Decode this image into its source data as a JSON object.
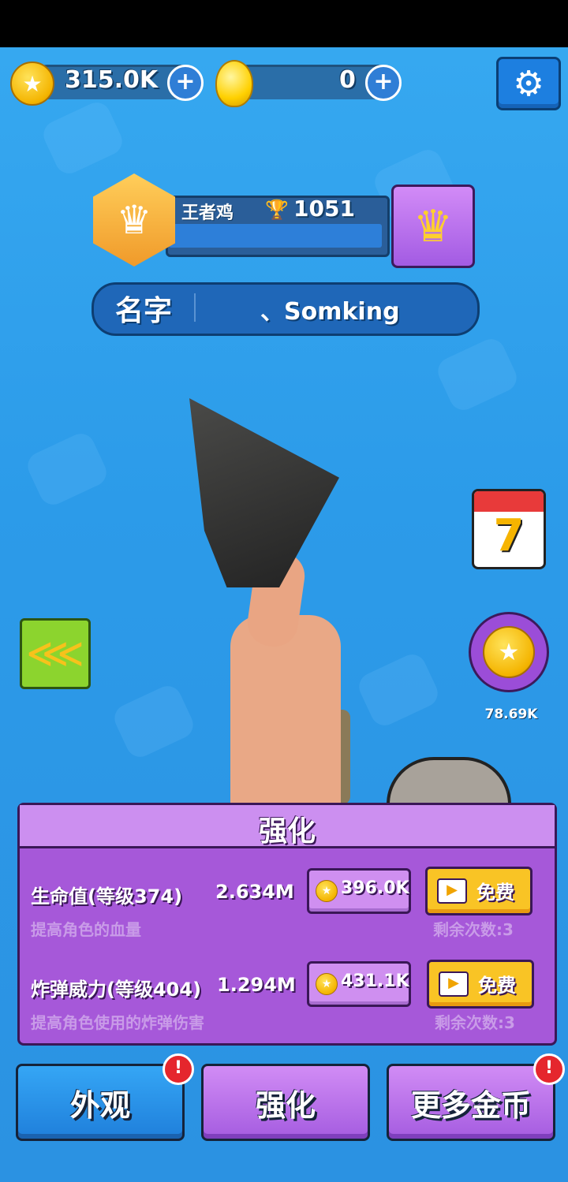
{
  "currency": {
    "coins_value": "315.0K",
    "eggs_value": "0"
  },
  "settings": {
    "icon": "gear-icon"
  },
  "rank": {
    "name": "王者鸡",
    "trophies": "1051"
  },
  "player": {
    "name_label": "名字",
    "name_value": "、Somking"
  },
  "side": {
    "calendar_day": "7",
    "offline_coins": "78.69K"
  },
  "upgrade_panel": {
    "title": "强化",
    "items": [
      {
        "name": "生命值(等级374)",
        "value": "2.634M",
        "description": "提高角色的血量",
        "cost": "396.0K",
        "free_label": "免费",
        "remaining": "剩余次数:3"
      },
      {
        "name": "炸弹威力(等级404)",
        "value": "1.294M",
        "description": "提高角色使用的炸弹伤害",
        "cost": "431.1K",
        "free_label": "免费",
        "remaining": "剩余次数:3"
      }
    ]
  },
  "tabs": [
    {
      "label": "外观",
      "alert": "!"
    },
    {
      "label": "强化"
    },
    {
      "label": "更多金币",
      "alert": "!"
    }
  ],
  "colors": {
    "background": "#2c9be9",
    "panel": "#a658d9",
    "button_yellow": "#f9c425",
    "tab_blue": "#1f7fdb",
    "tab_purple": "#a55ce0"
  }
}
